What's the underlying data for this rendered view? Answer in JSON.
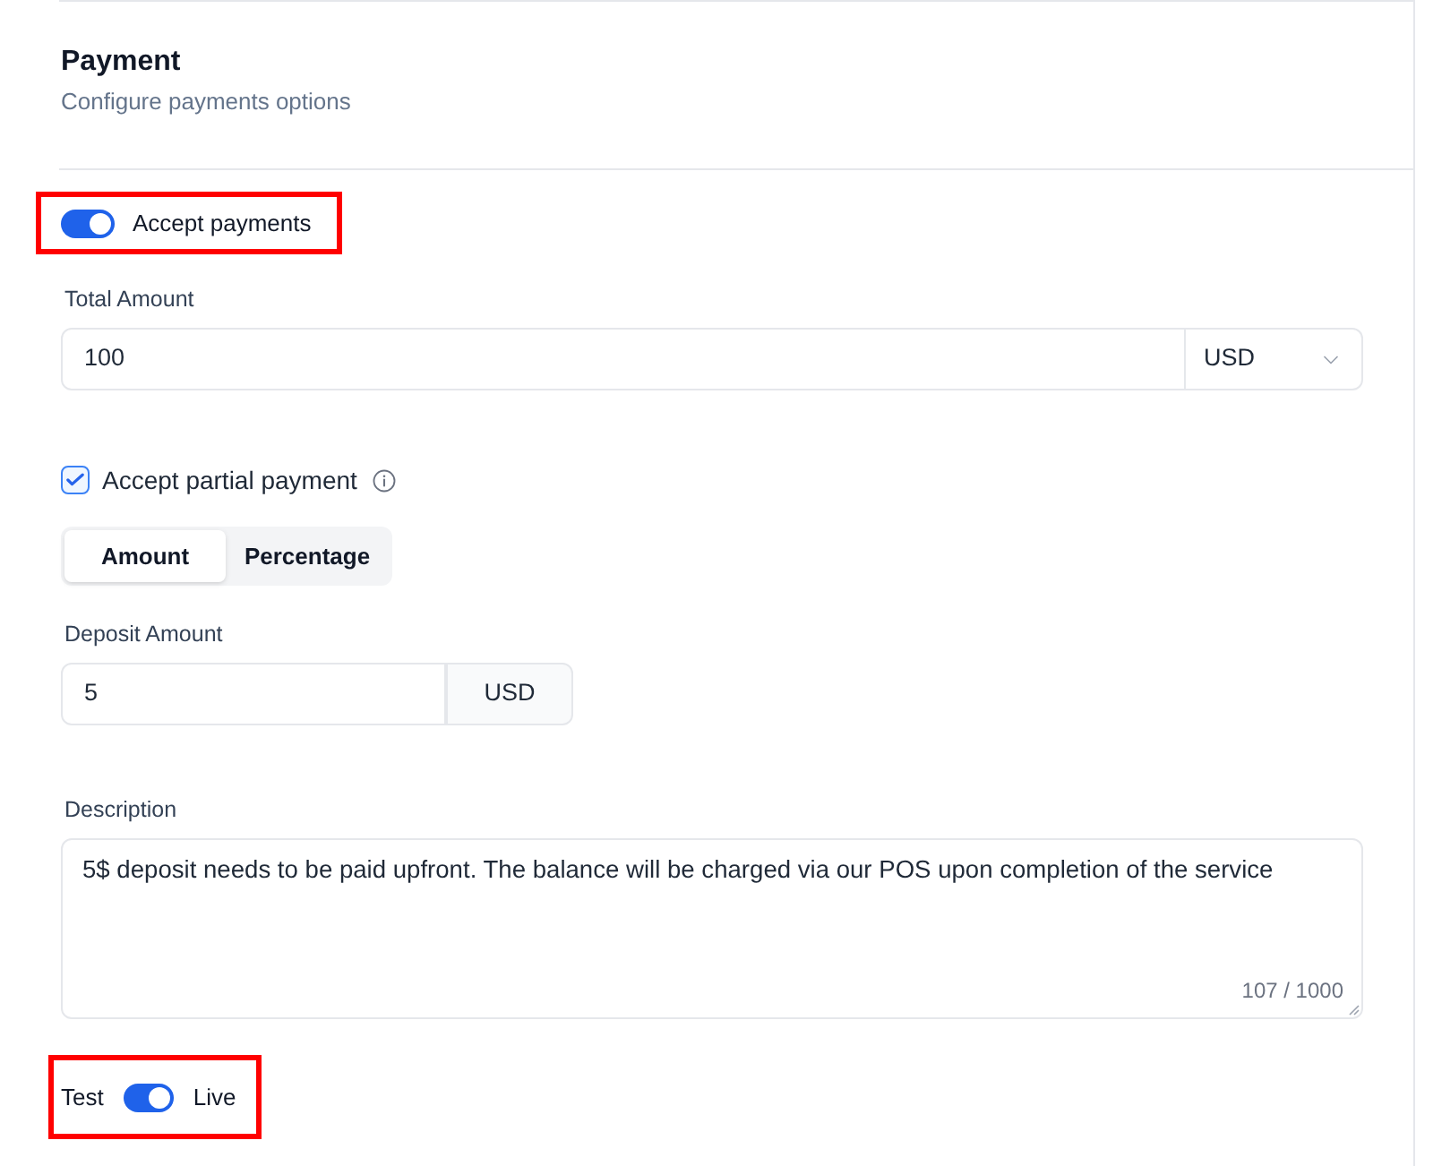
{
  "section": {
    "title": "Payment",
    "subtitle": "Configure payments options"
  },
  "accept_payments": {
    "label": "Accept payments",
    "on": true,
    "highlighted": true
  },
  "total_amount": {
    "label": "Total Amount",
    "value": "100",
    "currency": "USD"
  },
  "partial_payment": {
    "label": "Accept partial payment",
    "checked": true
  },
  "deposit_type_tabs": [
    {
      "label": "Amount",
      "selected": true
    },
    {
      "label": "Percentage",
      "selected": false
    }
  ],
  "deposit_amount": {
    "label": "Deposit Amount",
    "value": "5",
    "currency": "USD"
  },
  "description": {
    "label": "Description",
    "value": "5$ deposit needs to be paid upfront. The balance will be charged via our POS upon completion of the service",
    "counter": "107 / 1000"
  },
  "mode_toggle": {
    "off_label": "Test",
    "on_label": "Live",
    "on": true,
    "highlighted": true
  }
}
